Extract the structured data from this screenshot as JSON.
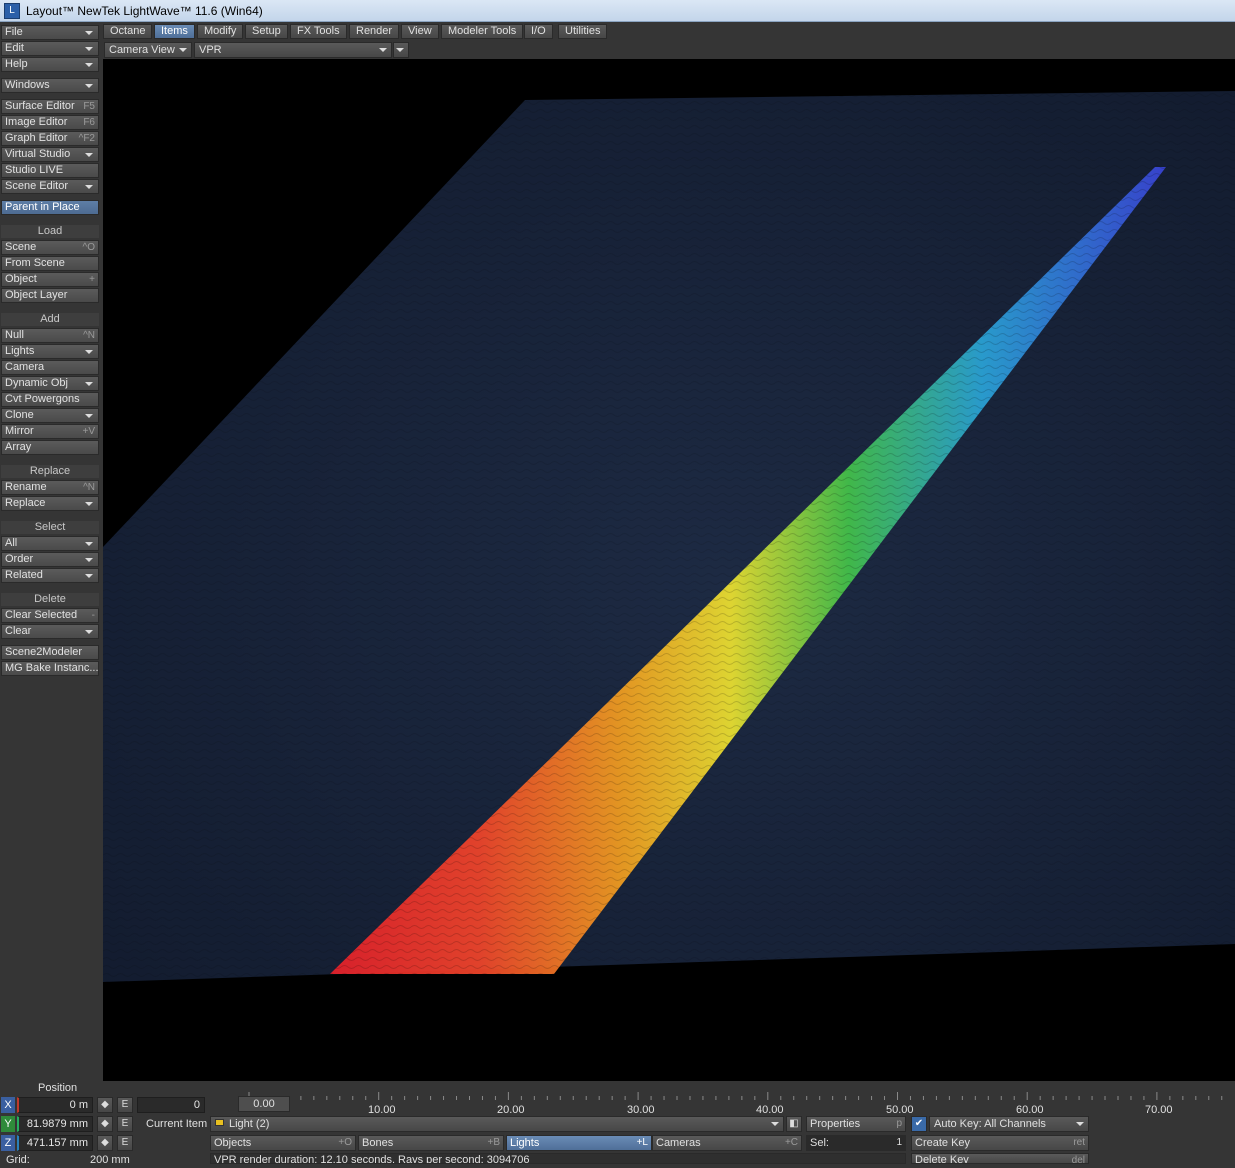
{
  "window": {
    "title": "Layout™ NewTek LightWave™ 11.6 (Win64)"
  },
  "left_menu": {
    "file": "File",
    "edit": "Edit",
    "help": "Help",
    "windows": "Windows",
    "surface_editor": "Surface Editor",
    "surface_editor_sc": "F5",
    "image_editor": "Image Editor",
    "image_editor_sc": "F6",
    "graph_editor": "Graph Editor",
    "graph_editor_sc": "^F2",
    "virtual_studio": "Virtual Studio",
    "studio_live": "Studio LIVE",
    "scene_editor": "Scene Editor",
    "parent_in_place": "Parent in Place",
    "load_header": "Load",
    "scene": "Scene",
    "scene_sc": "^O",
    "from_scene": "From Scene",
    "object": "Object",
    "object_sc": "+",
    "object_layer": "Object Layer",
    "add_header": "Add",
    "null": "Null",
    "null_sc": "^N",
    "lights": "Lights",
    "camera": "Camera",
    "dynamic_obj": "Dynamic Obj",
    "cvt_powergons": "Cvt Powergons",
    "clone": "Clone",
    "mirror": "Mirror",
    "mirror_sc": "+V",
    "array": "Array",
    "replace_header": "Replace",
    "rename": "Rename",
    "rename_sc": "^N",
    "replace": "Replace",
    "select_header": "Select",
    "all": "All",
    "order": "Order",
    "related": "Related",
    "delete_header": "Delete",
    "clear_selected": "Clear Selected",
    "clear_selected_sc": "-",
    "clear": "Clear",
    "scene2modeler": "Scene2Modeler",
    "mg_bake": "MG Bake Instanc..."
  },
  "tabs": [
    "Octane",
    "Items",
    "Modify",
    "Setup",
    "FX Tools",
    "Render",
    "View",
    "Modeler Tools",
    "I/O",
    "Utilities"
  ],
  "viewport": {
    "view_type": "Camera View",
    "render_mode": "VPR"
  },
  "position": {
    "label": "Position",
    "x_axis": "X",
    "y_axis": "Y",
    "z_axis": "Z",
    "x": "0 m",
    "y": "81.9879 mm",
    "z": "471.157 mm",
    "env": "E",
    "grid_label": "Grid:",
    "grid_value": "200 mm"
  },
  "timeline": {
    "frame": "0",
    "start": "0.00",
    "ticks": [
      "10.00",
      "20.00",
      "30.00",
      "40.00",
      "50.00",
      "60.00",
      "70.00"
    ]
  },
  "item_bar": {
    "current_item_label": "Current Item",
    "current_item": "Light (2)",
    "properties": "Properties",
    "properties_sc": "p",
    "objects": "Objects",
    "objects_sc": "+O",
    "bones": "Bones",
    "bones_sc": "+B",
    "lights": "Lights",
    "lights_sc": "+L",
    "cameras": "Cameras",
    "cameras_sc": "+C",
    "sel_label": "Sel:",
    "sel_value": "1",
    "status": "VPR render duration: 12.10 seconds. Rays per second: 3094706"
  },
  "keys": {
    "auto_key": "Auto Key: All Channels",
    "create_key": "Create Key",
    "create_key_sc": "ret",
    "delete_key": "Delete Key",
    "delete_key_sc": "del"
  },
  "colors": {
    "accent": "#5e7ea6",
    "panel": "#353535",
    "button": "#4f4f4f"
  }
}
